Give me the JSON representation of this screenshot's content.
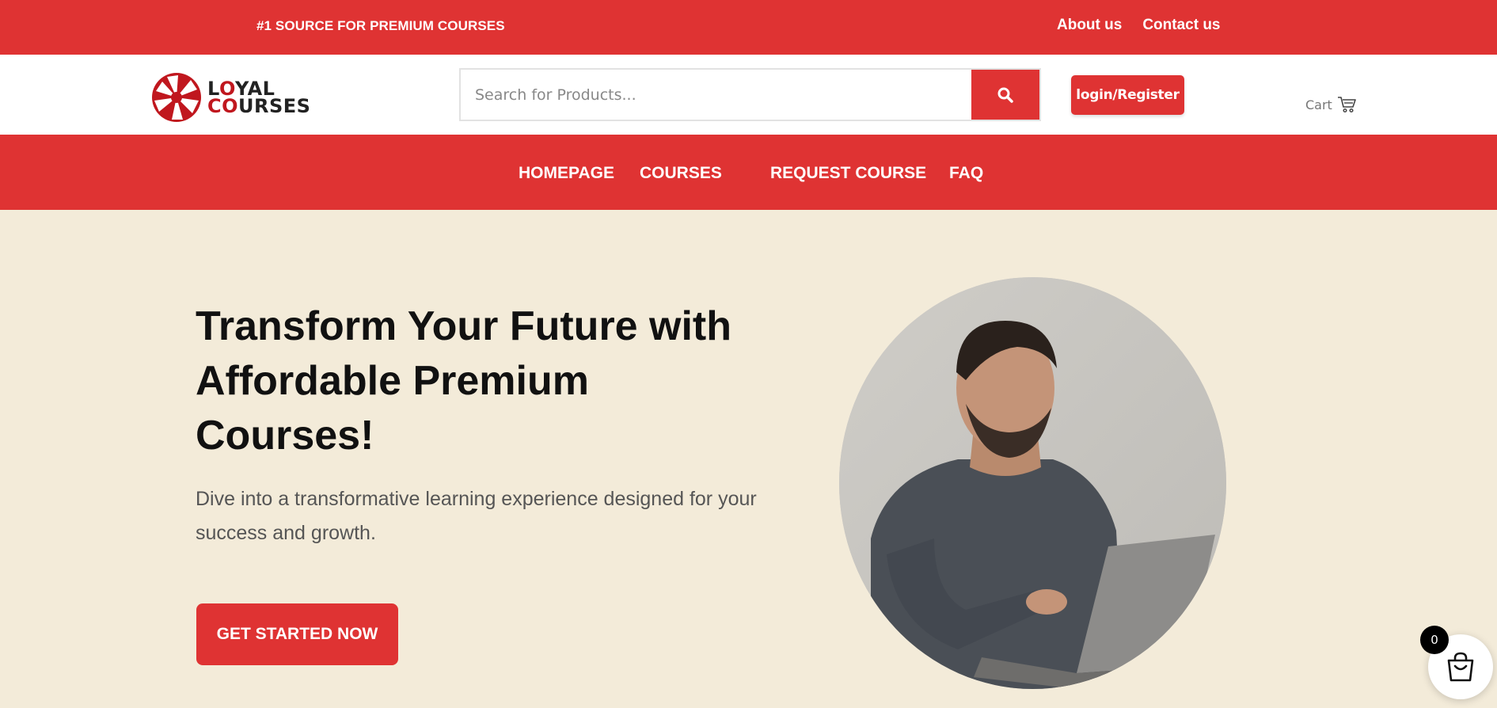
{
  "topbar": {
    "tagline": "#1 SOURCE FOR PREMIUM COURSES",
    "links": [
      "About us",
      "Contact us"
    ],
    "background": "#df3333"
  },
  "header": {
    "logo": {
      "line1_dark_a": "L",
      "line1_red": "O",
      "line1_dark_b": "YAL",
      "line2_red": "CO",
      "line2_dark": "URSES"
    },
    "search": {
      "placeholder": "Search for Products...",
      "icon": "search-icon"
    },
    "login_label": "login/Register",
    "cart_label": "Cart",
    "cart_icon": "cart-icon"
  },
  "nav": {
    "items": [
      "HOMEPAGE",
      "COURSES",
      "REQUEST COURSE",
      "FAQ"
    ]
  },
  "hero": {
    "title": "Transform Your Future with Affordable Premium Courses!",
    "subtitle": "Dive into a transformative learning experience designed for your success and growth.",
    "cta_label": "GET STARTED NOW",
    "image_icon": "person-with-laptop-photo"
  },
  "floating_cart": {
    "count": "0",
    "icon": "shopping-bag-icon"
  },
  "colors": {
    "accent": "#df3333",
    "hero_bg": "#f3ebd9",
    "logo_red": "#c0171e"
  }
}
